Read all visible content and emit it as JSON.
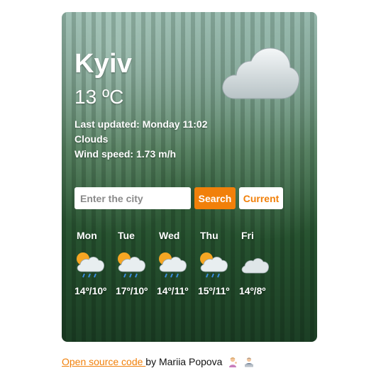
{
  "colors": {
    "accent": "#f1800a",
    "text_on_card": "#ffffff",
    "button_light_bg": "#ffffff"
  },
  "current": {
    "city": "Kyiv",
    "temperature": "13",
    "unit": "ºC",
    "last_updated": "Last updated: Monday 11:02",
    "description": "Clouds",
    "wind": "Wind speed: 1.73 m/h",
    "icon": "cloud-icon"
  },
  "search": {
    "placeholder": "Enter the city",
    "value": "",
    "search_label": "Search",
    "current_label": "Current"
  },
  "forecast": [
    {
      "day": "Mon",
      "temp": "14º/10º",
      "icon": "sun-cloud-rain-icon"
    },
    {
      "day": "Tue",
      "temp": "17º/10º",
      "icon": "sun-cloud-rain-icon"
    },
    {
      "day": "Wed",
      "temp": "14º/11º",
      "icon": "sun-cloud-rain-icon"
    },
    {
      "day": "Thu",
      "temp": "15º/11º",
      "icon": "sun-cloud-rain-icon"
    },
    {
      "day": "Fri",
      "temp": "14º/8º",
      "icon": "cloud-icon"
    }
  ],
  "footer": {
    "link_text": "Open source code ",
    "author_text": "by Mariia Popova",
    "emojis": [
      "person-tipping-hand-icon",
      "woman-technologist-icon"
    ]
  }
}
